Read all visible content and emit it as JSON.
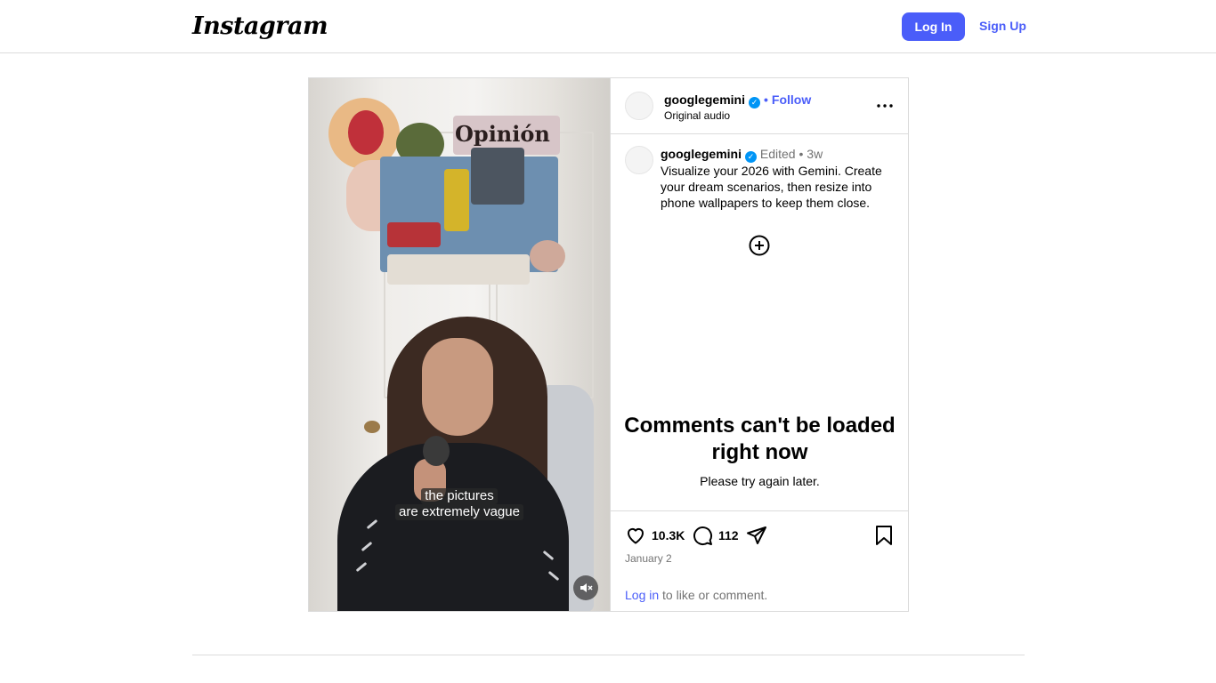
{
  "header": {
    "logo": "Instagram",
    "login_label": "Log In",
    "signup_label": "Sign Up"
  },
  "post": {
    "video_caption_line1": "the pictures",
    "video_caption_line2": "are extremely vague",
    "author": {
      "username": "googlegemini",
      "verified": true,
      "follow_label": "Follow",
      "audio": "Original audio"
    },
    "caption": {
      "username": "googlegemini",
      "edited": "Edited",
      "age": "3w",
      "text": "Visualize your 2026 with Gemini. Create your dream scenarios, then resize into phone wallpapers to keep them close."
    },
    "comments_error": {
      "title": "Comments can't be loaded right now",
      "subtitle": "Please try again later."
    },
    "actions": {
      "likes": "10.3K",
      "comments": "112"
    },
    "date": "January 2",
    "login_prompt": {
      "link": "Log in",
      "rest": " to like or comment."
    }
  },
  "colors": {
    "accent": "#4a5df9",
    "verified": "#0095f6",
    "border": "#dbdbdb",
    "muted_text": "#737373"
  },
  "icons": [
    "more-icon",
    "verified-icon",
    "plus-circle-icon",
    "heart-icon",
    "comment-icon",
    "share-icon",
    "bookmark-icon",
    "mute-icon"
  ]
}
